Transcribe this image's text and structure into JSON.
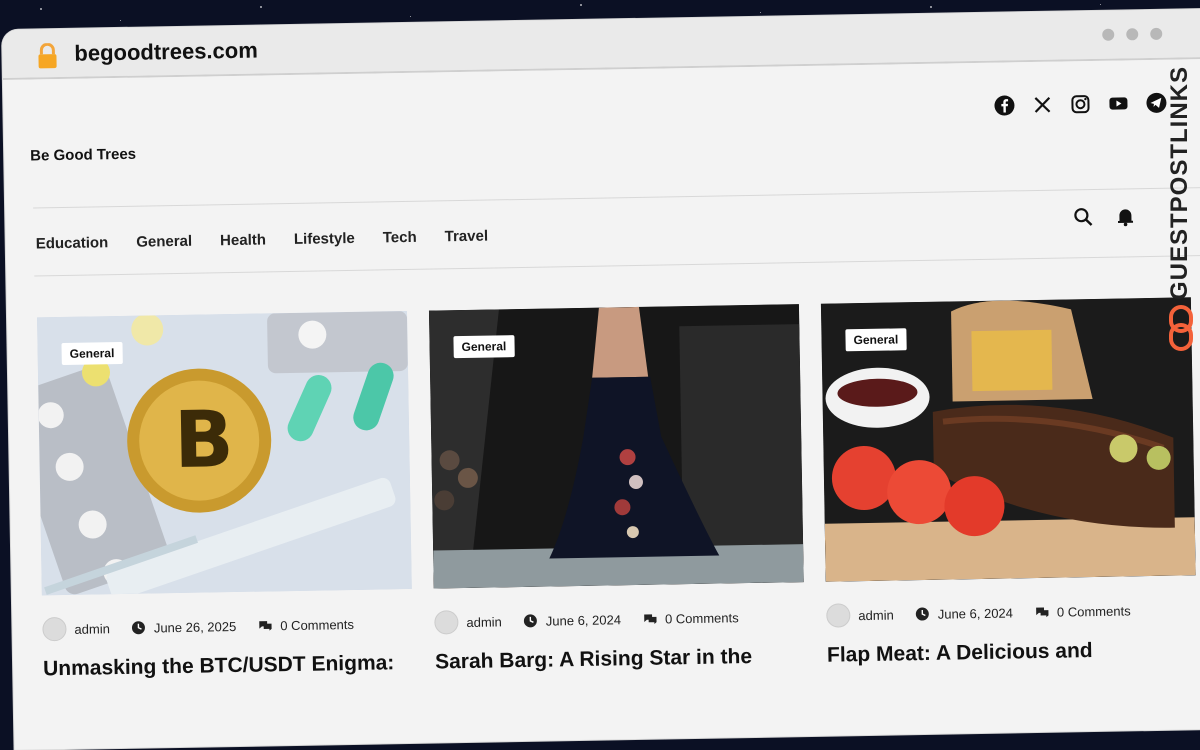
{
  "browser": {
    "url": "begoodtrees.com"
  },
  "site": {
    "title": "Be Good Trees"
  },
  "social_icons": [
    "facebook-icon",
    "x-icon",
    "instagram-icon",
    "youtube-icon",
    "telegram-icon"
  ],
  "nav": {
    "items": [
      "Education",
      "General",
      "Health",
      "Lifestyle",
      "Tech",
      "Travel"
    ]
  },
  "header_tools": [
    "search-icon",
    "bell-icon"
  ],
  "posts": [
    {
      "category": "General",
      "author": "admin",
      "date": "June 26, 2025",
      "comments": "0 Comments",
      "title": "Unmasking the BTC/USDT Enigma:"
    },
    {
      "category": "General",
      "author": "admin",
      "date": "June 6, 2024",
      "comments": "0 Comments",
      "title": "Sarah Barg: A Rising Star in the"
    },
    {
      "category": "General",
      "author": "admin",
      "date": "June 6, 2024",
      "comments": "0 Comments",
      "title": "Flap Meat: A Delicious and"
    }
  ],
  "watermark": {
    "text": "GUESTPOSTLINKS"
  },
  "colors": {
    "accent": "#f4623a",
    "background": "#0b1024",
    "page": "#f3f3f3"
  }
}
